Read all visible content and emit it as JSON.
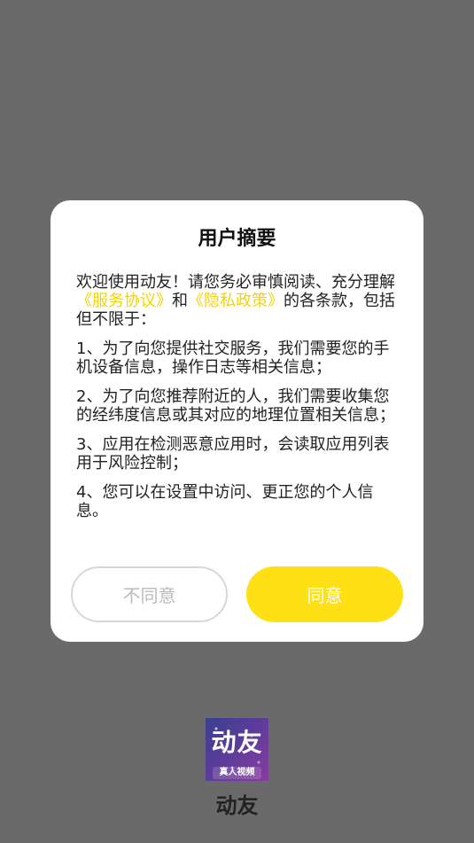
{
  "dialog": {
    "title": "用户摘要",
    "intro": {
      "prefix": "欢迎使用动友！请您务必审慎阅读、充分理解",
      "link1": "《服务协议》",
      "mid": "和",
      "link2": "《隐私政策》",
      "suffix": "的各条款，包括但不限于："
    },
    "items": [
      "1、为了向您提供社交服务，我们需要您的手机设备信息，操作日志等相关信息；",
      "2、为了向您推荐附近的人，我们需要收集您的经纬度信息或其对应的地理位置相关信息；",
      "3、应用在检测恶意应用时，会读取应用列表用于风险控制；",
      "4、您可以在设置中访问、更正您的个人信息。"
    ],
    "buttons": {
      "disagree": "不同意",
      "agree": "同意"
    }
  },
  "app": {
    "logo_text": "动友",
    "logo_sub": "真人视频",
    "name": "动友"
  },
  "colors": {
    "overlay": "#6a6a6a",
    "accent": "#ffe014",
    "link": "#f5d400"
  }
}
